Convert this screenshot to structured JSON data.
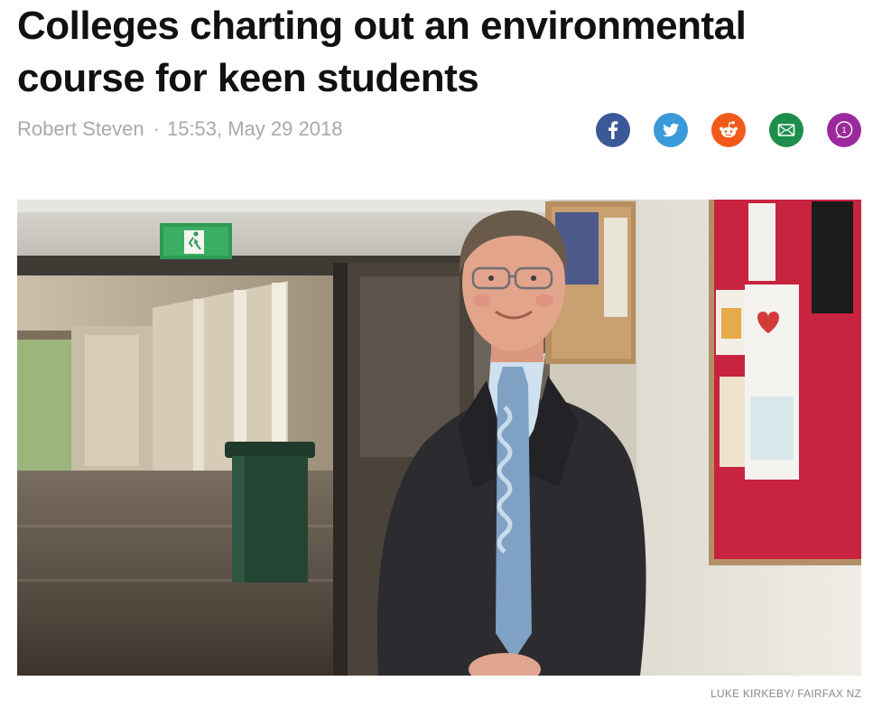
{
  "article": {
    "headline": "Colleges charting out an environmental course for keen students",
    "author": "Robert Steven",
    "separator": "·",
    "timestamp": "15:53, May 29 2018"
  },
  "share": {
    "buttons": [
      {
        "name": "facebook",
        "icon": "facebook-icon",
        "color": "#3b5998"
      },
      {
        "name": "twitter",
        "icon": "twitter-bird-icon",
        "color": "#3a9ad9"
      },
      {
        "name": "reddit",
        "icon": "reddit-icon",
        "color": "#f25a1b"
      },
      {
        "name": "email",
        "icon": "envelope-icon",
        "color": "#1e8e4d"
      },
      {
        "name": "comments",
        "icon": "comment-bubble-icon",
        "color": "#9c2a9c",
        "count": "1"
      }
    ]
  },
  "photo": {
    "exit_sign_icon": "exit-running-man-icon",
    "credit": "LUKE KIRKEBY/ FAIRFAX NZ"
  }
}
